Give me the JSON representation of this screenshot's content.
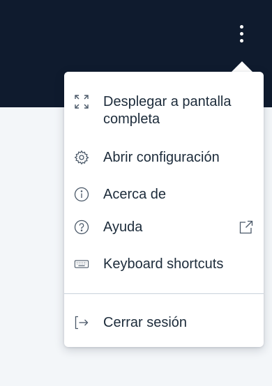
{
  "menu": {
    "items": [
      {
        "label": "Desplegar a pantalla completa",
        "icon": "expand-icon"
      },
      {
        "label": "Abrir configuración",
        "icon": "gear-icon"
      },
      {
        "label": "Acerca de",
        "icon": "info-icon"
      },
      {
        "label": "Ayuda",
        "icon": "help-icon",
        "trailing_icon": "external-link-icon"
      },
      {
        "label": "Keyboard shortcuts",
        "icon": "keyboard-icon"
      },
      {
        "label": "Cerrar sesión",
        "icon": "logout-icon"
      }
    ]
  },
  "colors": {
    "topbar": "#0f1b2e",
    "background": "#f3f6f9",
    "menu_background": "#ffffff",
    "text": "#1c2b3a",
    "icon": "#4a5868"
  }
}
